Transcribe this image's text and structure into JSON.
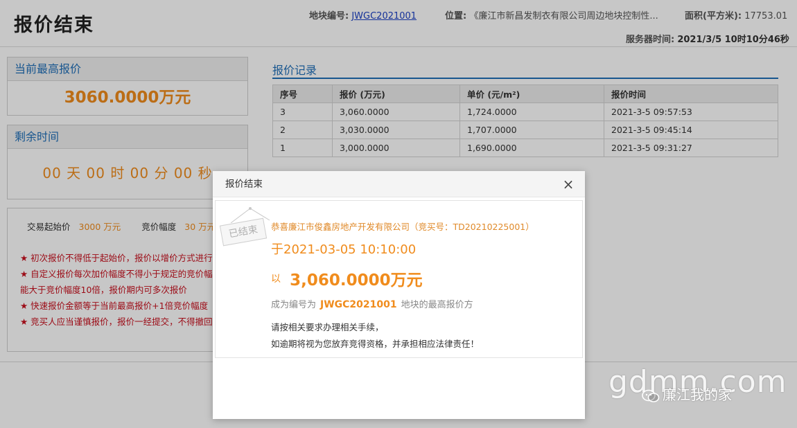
{
  "header": {
    "title": "报价结束",
    "plot_label": "地块编号:",
    "plot_code": "JWGC2021001",
    "location_label": "位置:",
    "location_value": "《廉江市新昌发制衣有限公司周边地块控制性...",
    "area_label": "面积(平方米):",
    "area_value": "17753.01",
    "server_time_label": "服务器时间:",
    "server_time_value": "2021/3/5 10时10分46秒"
  },
  "highest": {
    "title": "当前最高报价",
    "price": "3060.0000万元"
  },
  "remaining": {
    "title": "剩余时间",
    "countdown": "00 天 00 时 00 分 00 秒"
  },
  "rules": {
    "start_label": "交易起始价",
    "start_value": "3000 万元",
    "step_label": "竞价幅度",
    "step_value": "30 万元",
    "items": [
      "★ 初次报价不得低于起始价，报价以增价方式进行",
      "★ 自定义报价每次加价幅度不得小于规定的竞价幅度，不能大于竞价幅度10倍，报价期内可多次报价",
      "★ 快速报价金额等于当前最高报价+1倍竞价幅度",
      "★ 竞买人应当谨慎报价，报价一经提交，不得撤回、撤销"
    ]
  },
  "records": {
    "title": "报价记录",
    "headers": [
      "序号",
      "报价 (万元)",
      "单价 (元/m²)",
      "报价时间"
    ],
    "rows": [
      [
        "3",
        "3,060.0000",
        "1,724.0000",
        "2021-3-5 09:57:53"
      ],
      [
        "2",
        "3,030.0000",
        "1,707.0000",
        "2021-3-5 09:45:14"
      ],
      [
        "1",
        "3,000.0000",
        "1,690.0000",
        "2021-3-5 09:31:27"
      ]
    ]
  },
  "modal": {
    "title": "报价结束",
    "close": "×",
    "stamp": "已结束",
    "congrats": "恭喜廉江市俊鑫房地产开发有限公司（竞买号：TD20210225001）",
    "date_line": "于2021-03-05 10:10:00",
    "price_prefix": "以",
    "price_value": "3,060.0000万元",
    "winner_prefix": "成为编号为",
    "winner_code": "JWGC2021001",
    "winner_suffix": "地块的最高报价方",
    "note1": "请按相关要求办理相关手续，",
    "note2": "如逾期将视为您放弃竞得资格，并承担相应法律责任！"
  },
  "watermark": {
    "site": "gdmm.com",
    "account": "廉江我的家"
  }
}
